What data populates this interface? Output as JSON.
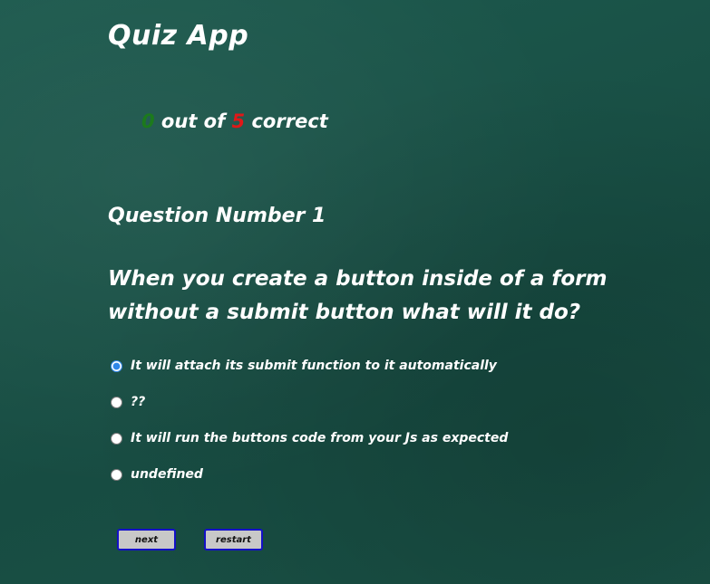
{
  "app": {
    "title": "Quiz App"
  },
  "score": {
    "correct": "0",
    "middle_text": " out of ",
    "total": "5",
    "suffix_text": " correct",
    "correct_color": "#1c7a1c",
    "total_color": "#e01818"
  },
  "question": {
    "number_label": "Question Number 1",
    "text": "When you create a button inside of a form without a submit button what will it do?"
  },
  "answers": [
    {
      "label": "It will attach its submit function to it automatically",
      "selected": true
    },
    {
      "label": "??",
      "selected": false
    },
    {
      "label": "It will run the buttons code from your Js as expected",
      "selected": false
    },
    {
      "label": "undefined",
      "selected": false
    }
  ],
  "buttons": {
    "next_label": "next",
    "restart_label": "Restart"
  },
  "colors": {
    "background": "#1b5248",
    "button_border": "#1410c8",
    "button_bg": "#c8c8c8",
    "radio_selected": "#2f86e8"
  }
}
